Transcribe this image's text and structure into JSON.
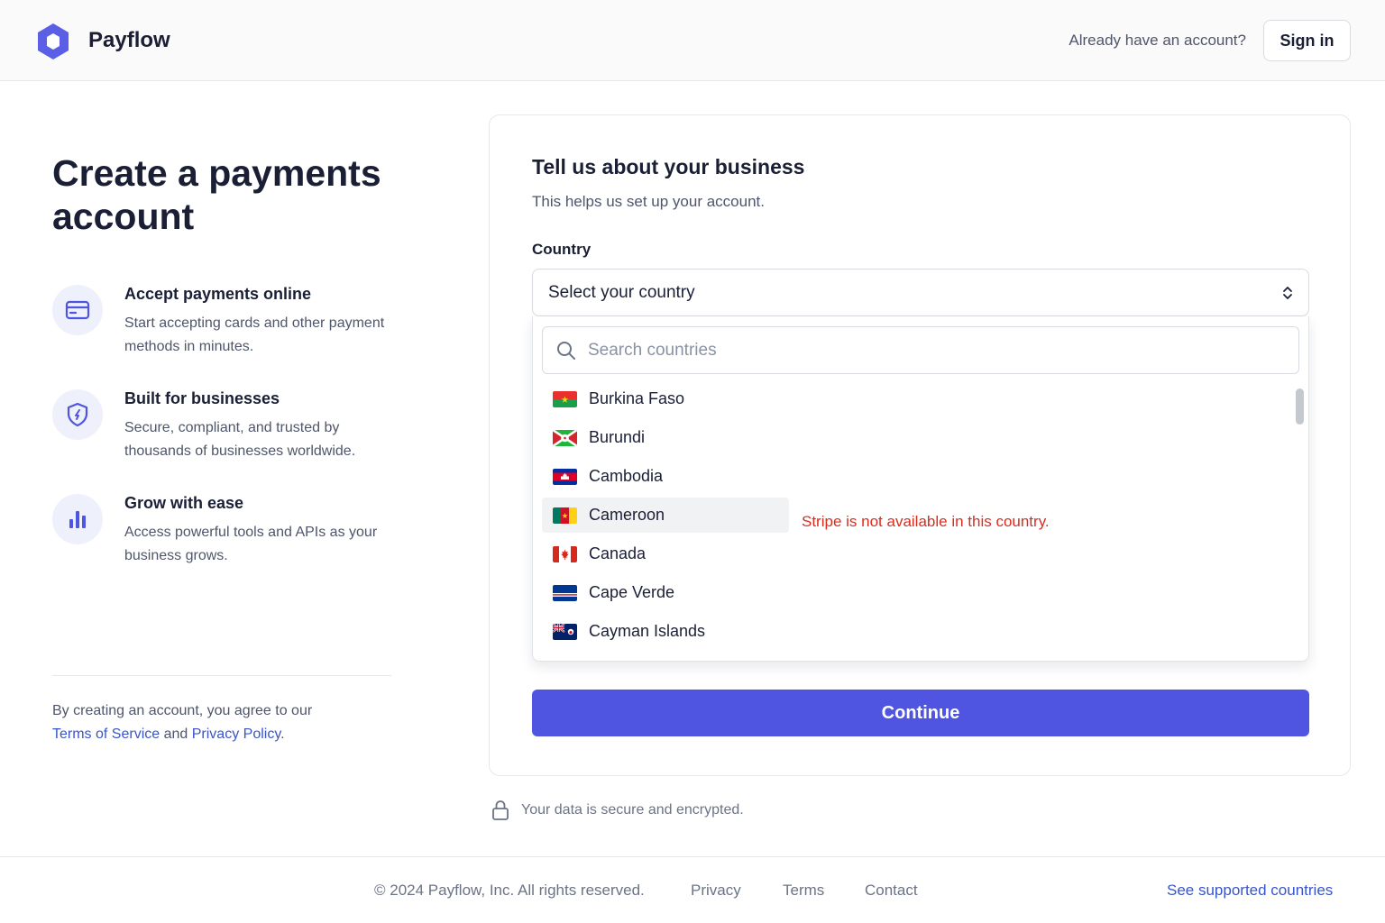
{
  "header": {
    "brand": "Payflow",
    "already_text": "Already have an account?",
    "signin_label": "Sign in"
  },
  "hero": {
    "title": "Create a payments account"
  },
  "features": [
    {
      "title": "Accept payments online",
      "desc": "Start accepting cards and other payment methods in minutes.",
      "icon": "credit-card-icon"
    },
    {
      "title": "Built for businesses",
      "desc": "Secure, compliant, and trusted by thousands of businesses worldwide.",
      "icon": "shield-icon"
    },
    {
      "title": "Grow with ease",
      "desc": "Access powerful tools and APIs as your business grows.",
      "icon": "bar-chart-icon"
    }
  ],
  "legal": {
    "prefix": "By creating an account, you agree to our",
    "terms": "Terms of Service",
    "and": "and",
    "privacy": "Privacy Policy",
    "suffix": "."
  },
  "card": {
    "title": "Tell us about your business",
    "subtitle": "This helps us set up your account.",
    "country_label": "Country",
    "select_placeholder": "Select your country",
    "search_placeholder": "Search countries",
    "countries": [
      {
        "name": "Burkina Faso",
        "flag": "burkina-faso-flag",
        "highlighted": false
      },
      {
        "name": "Burundi",
        "flag": "burundi-flag",
        "highlighted": false
      },
      {
        "name": "Cambodia",
        "flag": "cambodia-flag",
        "highlighted": false
      },
      {
        "name": "Cameroon",
        "flag": "cameroon-flag",
        "highlighted": true
      },
      {
        "name": "Canada",
        "flag": "canada-flag",
        "highlighted": false
      },
      {
        "name": "Cape Verde",
        "flag": "cape-verde-flag",
        "highlighted": false
      },
      {
        "name": "Cayman Islands",
        "flag": "cayman-islands-flag",
        "highlighted": false
      }
    ],
    "error_text": "Stripe is not available in this country.",
    "continue_label": "Continue"
  },
  "secure_text": "Your data is secure and encrypted.",
  "footer": {
    "copyright": "© 2024 Payflow, Inc. All rights reserved.",
    "privacy": "Privacy",
    "terms": "Terms",
    "contact": "Contact",
    "supported": "See supported countries"
  },
  "colors": {
    "accent": "#4f55e0",
    "link": "#3a55c8",
    "error": "#d92d20",
    "icon_bg": "#eef0fb"
  }
}
